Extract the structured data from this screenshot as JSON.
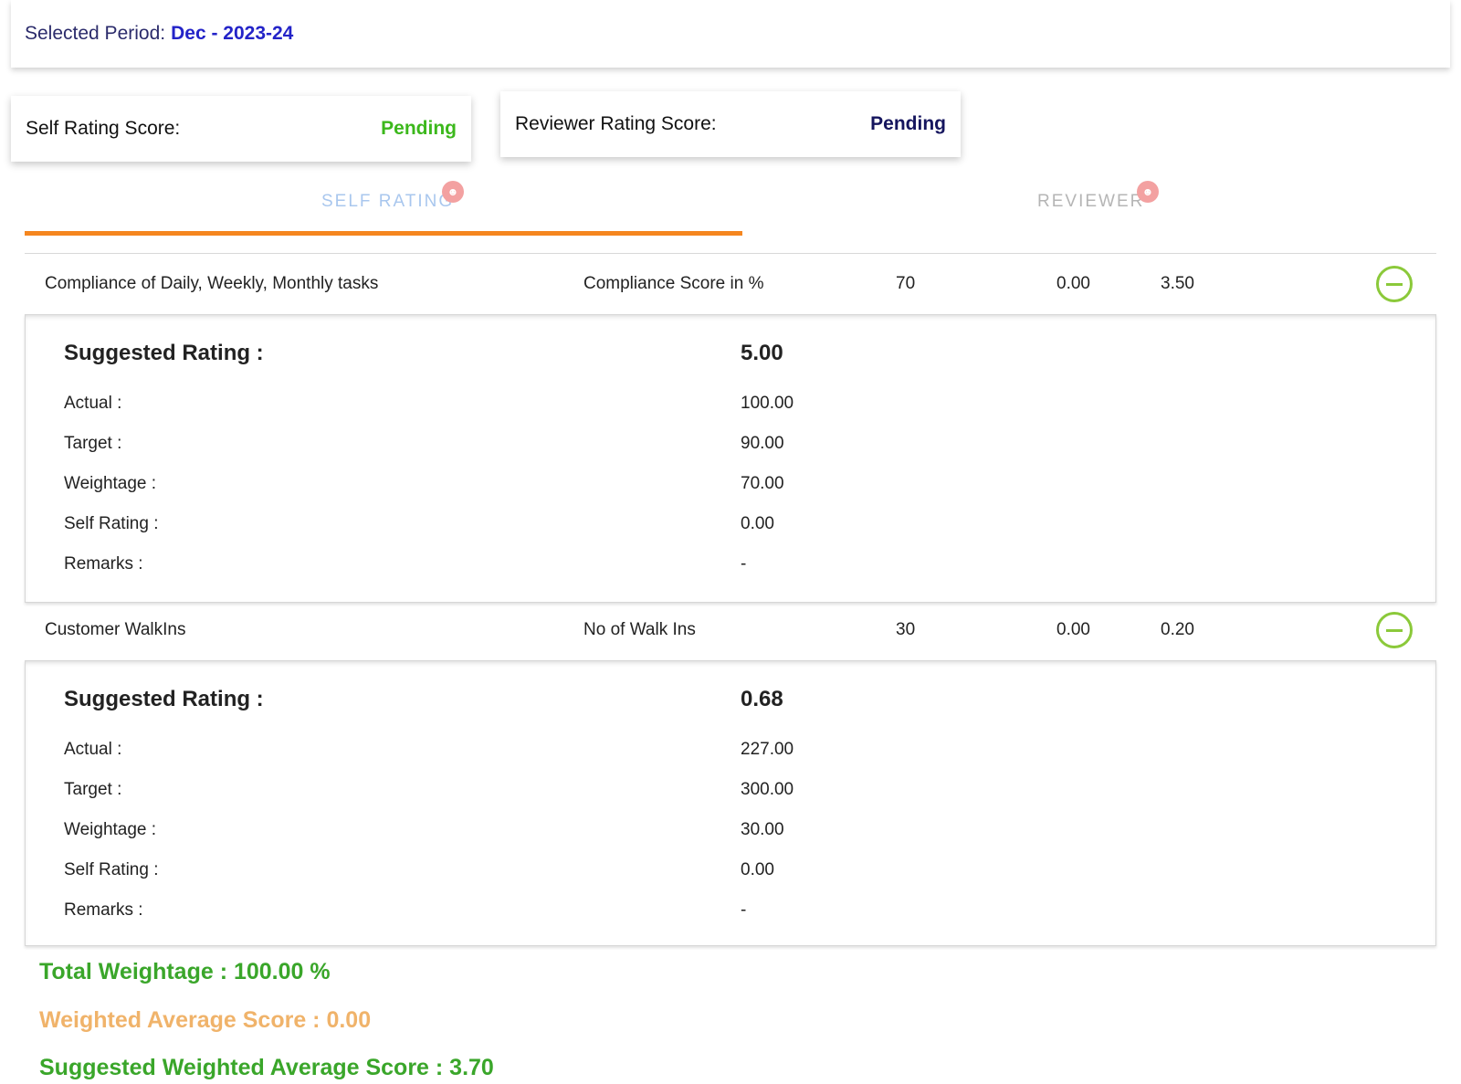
{
  "period": {
    "label": "Selected Period:",
    "value": "Dec - 2023-24"
  },
  "scores": {
    "self": {
      "label": "Self Rating Score:",
      "status": "Pending",
      "status_color": "#3cb81c"
    },
    "reviewer": {
      "label": "Reviewer Rating Score:",
      "status": "Pending",
      "status_color": "#15155e"
    }
  },
  "tabs": [
    {
      "label": "SELF RATING",
      "active": true
    },
    {
      "label": "REVIEWER",
      "active": false
    }
  ],
  "accent_color": "#f5861f",
  "kpis": [
    {
      "name": "Compliance of Daily, Weekly, Monthly tasks",
      "measure": "Compliance Score in %",
      "weightage": "70",
      "self_rating": "0.00",
      "suggested": "3.50",
      "details": {
        "suggested_label": "Suggested Rating :",
        "suggested_value": "5.00",
        "actual_label": "Actual :",
        "actual_value": "100.00",
        "target_label": "Target :",
        "target_value": "90.00",
        "weightage_label": "Weightage :",
        "weightage_value": "70.00",
        "self_label": "Self Rating :",
        "self_value": "0.00",
        "remarks_label": "Remarks :",
        "remarks_value": "-"
      }
    },
    {
      "name": "Customer WalkIns",
      "measure": "No of Walk Ins",
      "weightage": "30",
      "self_rating": "0.00",
      "suggested": "0.20",
      "details": {
        "suggested_label": "Suggested Rating :",
        "suggested_value": "0.68",
        "actual_label": "Actual :",
        "actual_value": "227.00",
        "target_label": "Target :",
        "target_value": "300.00",
        "weightage_label": "Weightage :",
        "weightage_value": "30.00",
        "self_label": "Self Rating :",
        "self_value": "0.00",
        "remarks_label": "Remarks :",
        "remarks_value": "-"
      }
    }
  ],
  "summary": {
    "total_weightage": "Total Weightage : 100.00 %",
    "weighted_average": "Weighted Average Score : 0.00",
    "suggested_weighted_average": "Suggested Weighted Average Score : 3.70"
  }
}
